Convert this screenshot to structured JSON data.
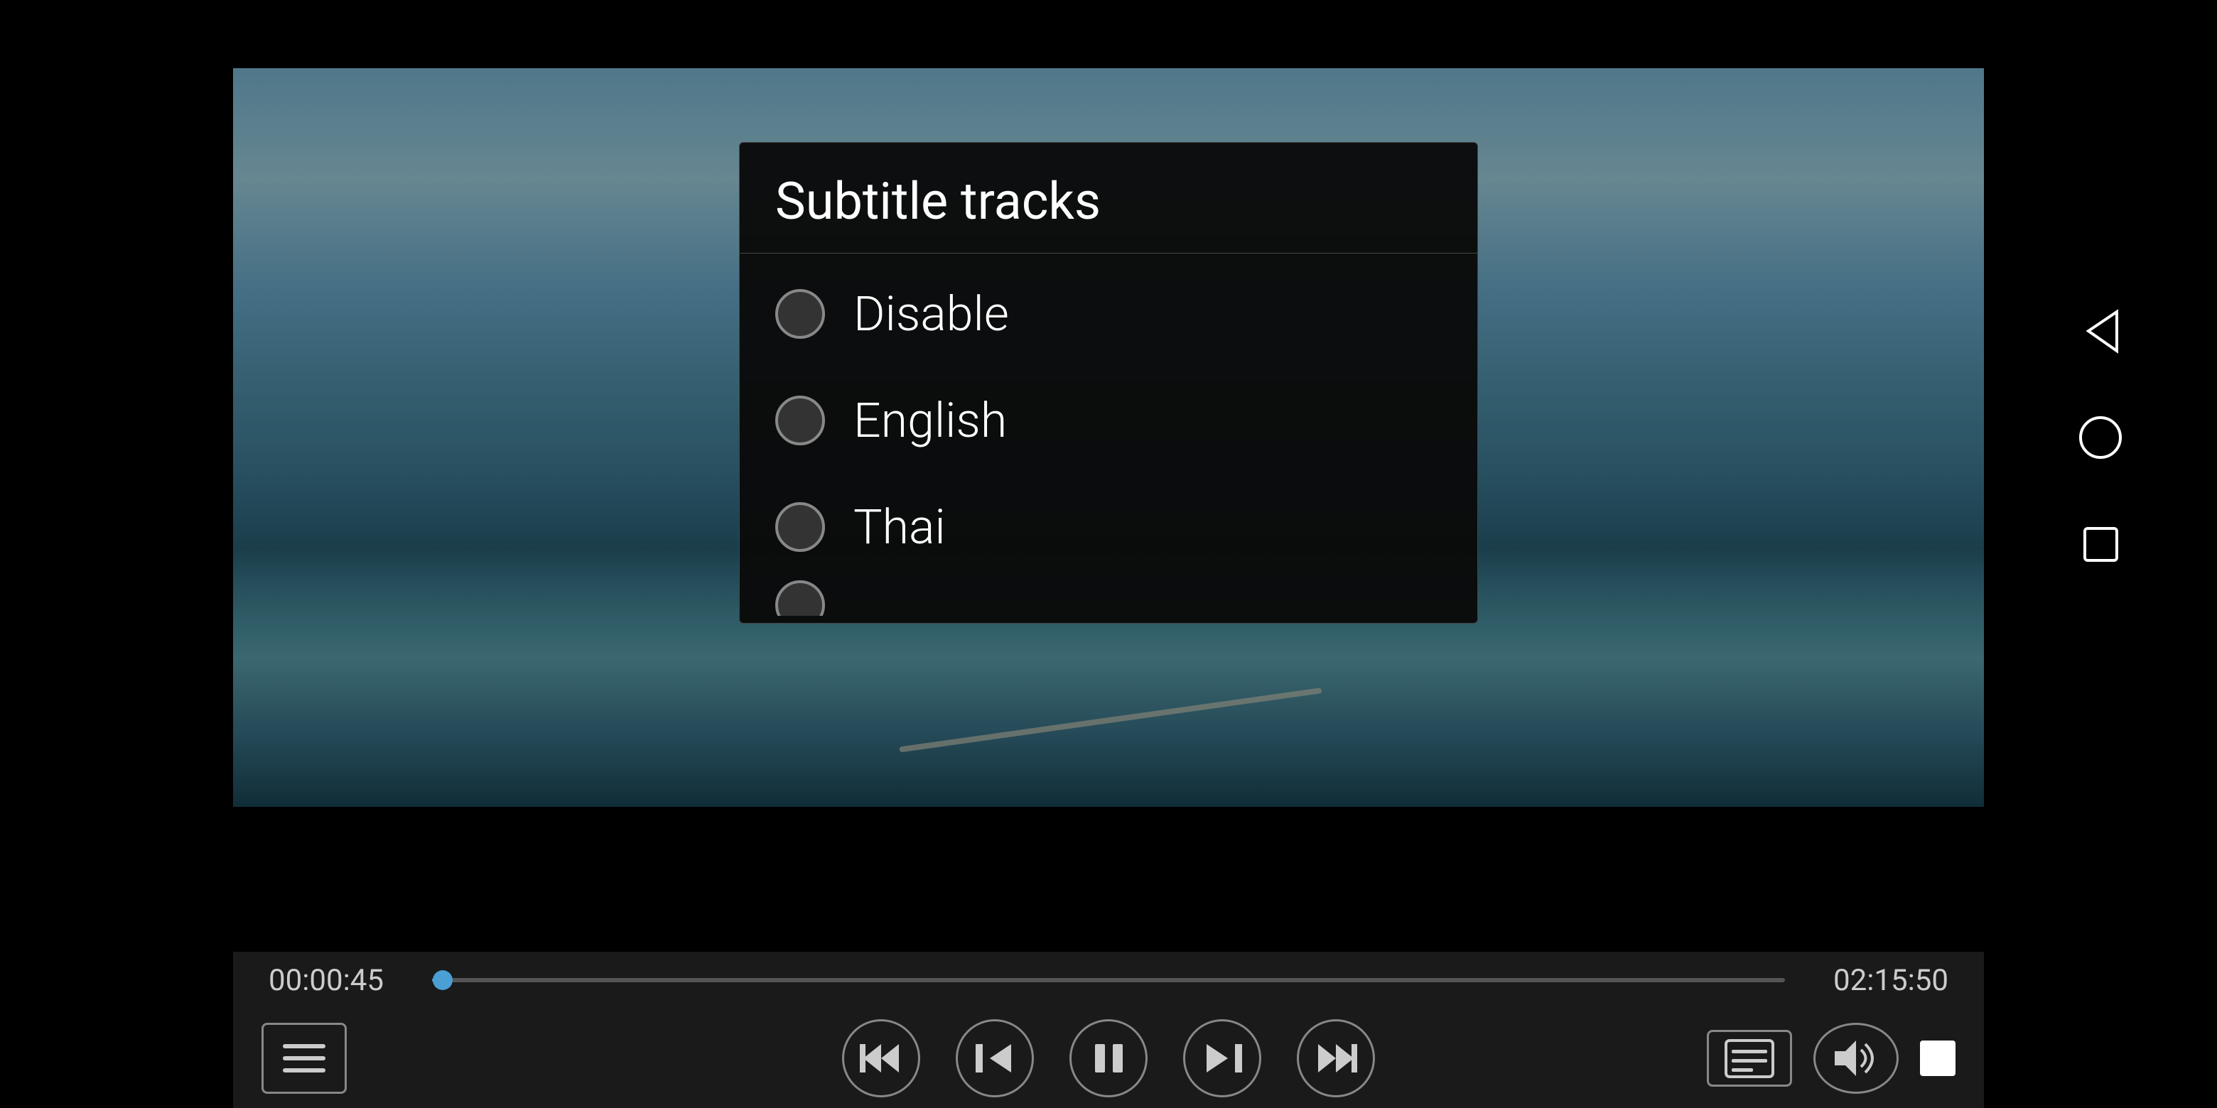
{
  "player": {
    "time_start": "00:00:45",
    "time_end": "02:15:50",
    "progress_percent": 0.8
  },
  "controls": {
    "playlist_icon": "☰",
    "rewind_icon": "⏪",
    "prev_icon": "⏮",
    "pause_icon": "⏸",
    "next_icon": "⏭",
    "fast_forward_icon": "⏩",
    "subtitle_icon": "▤",
    "volume_icon": "🔊"
  },
  "phone_buttons": {
    "back_icon": "◁",
    "circle_icon": "○",
    "square_icon": "□"
  },
  "dialog": {
    "title": "Subtitle tracks",
    "options": [
      {
        "id": "disable",
        "label": "Disable",
        "selected": false
      },
      {
        "id": "english",
        "label": "English",
        "selected": false
      },
      {
        "id": "thai",
        "label": "Thai",
        "selected": false
      }
    ],
    "partial_more": true
  }
}
